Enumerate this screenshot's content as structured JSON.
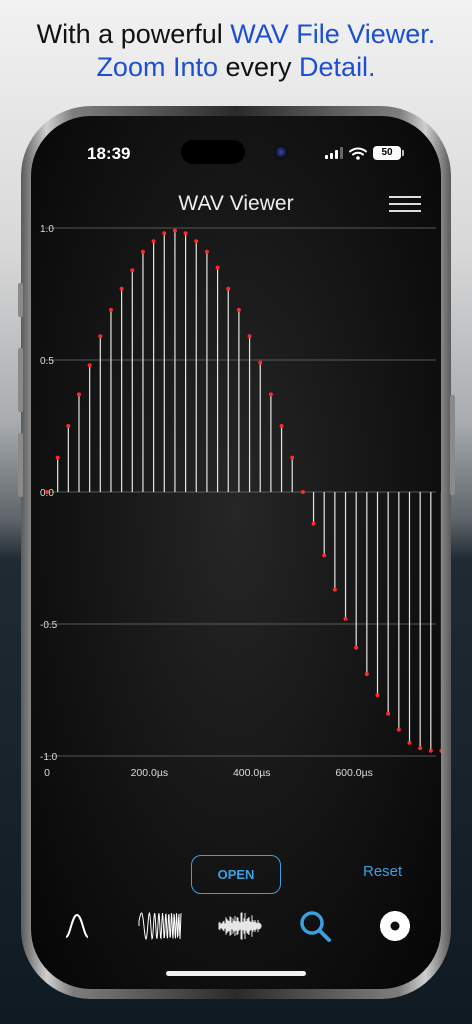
{
  "headline": {
    "line1_prefix": "With a powerful ",
    "line1_highlight": "WAV File Viewer.",
    "line2_highlight_a": "Zoom Into",
    "line2_middle": " every ",
    "line2_highlight_b": "Detail."
  },
  "status_bar": {
    "time": "18:39",
    "battery": "50"
  },
  "app": {
    "title": "WAV Viewer"
  },
  "chart_data": {
    "type": "stem",
    "title": "",
    "xlabel": "",
    "ylabel": "",
    "ylim": [
      -1.0,
      1.0
    ],
    "xlim": [
      0,
      760
    ],
    "x_ticks": [
      "0",
      "200.0µs",
      "400.0µs",
      "600.0µs"
    ],
    "x_tick_values": [
      0,
      200,
      400,
      600
    ],
    "y_ticks": [
      "1.0",
      "0.5",
      "0.0",
      "-0.5",
      "-1.0"
    ],
    "y_tick_values": [
      1.0,
      0.5,
      0.0,
      -0.5,
      -1.0
    ],
    "x_unit": "µs",
    "sample_interval": 20.83,
    "values": [
      0.0,
      0.13,
      0.25,
      0.37,
      0.48,
      0.59,
      0.69,
      0.77,
      0.84,
      0.91,
      0.95,
      0.98,
      0.99,
      0.98,
      0.95,
      0.91,
      0.85,
      0.77,
      0.69,
      0.59,
      0.49,
      0.37,
      0.25,
      0.13,
      0.0,
      -0.12,
      -0.24,
      -0.37,
      -0.48,
      -0.59,
      -0.69,
      -0.77,
      -0.84,
      -0.9,
      -0.95,
      -0.97,
      -0.98,
      -0.98
    ],
    "colors": {
      "stem": "#e6e6e6",
      "marker": "#ff2a2a",
      "grid": "#6f6f6f",
      "tick_text": "#dddddd"
    }
  },
  "controls": {
    "open_label": "OPEN",
    "reset_label": "Reset"
  },
  "tabbar": {
    "items": [
      {
        "name": "sine-wave-icon"
      },
      {
        "name": "waveform-oscillation-icon"
      },
      {
        "name": "noise-waveform-icon"
      },
      {
        "name": "search-icon",
        "active": true
      },
      {
        "name": "gear-icon"
      }
    ],
    "active_color": "#3aa0e0",
    "inactive_color": "#ffffff"
  }
}
